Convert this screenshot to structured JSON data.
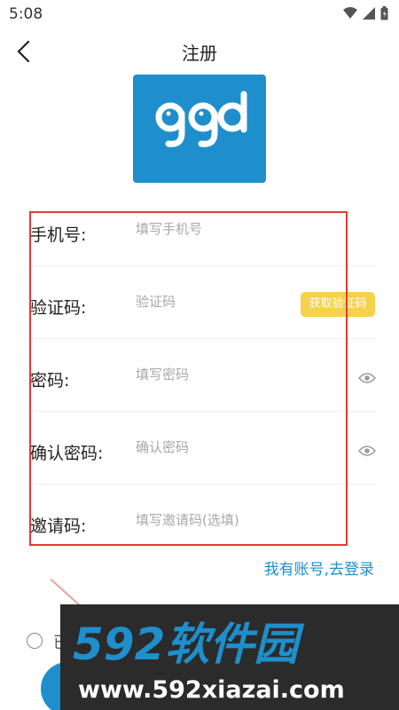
{
  "status_bar": {
    "time": "5:08",
    "icons": [
      "wifi-icon",
      "cellular-icon",
      "battery-icon"
    ]
  },
  "nav": {
    "title": "注册",
    "back_icon": "chevron-left-icon"
  },
  "logo": {
    "text": "ggd",
    "background_color": "#1e8fcc"
  },
  "form": {
    "rows": [
      {
        "label": "手机号:",
        "placeholder": "填写手机号"
      },
      {
        "label": "验证码:",
        "placeholder": "验证码",
        "action_label": "获取验证码"
      },
      {
        "label": "密码:",
        "placeholder": "填写密码",
        "icon": "eye-icon"
      },
      {
        "label": "确认密码:",
        "placeholder": "确认密码",
        "icon": "eye-icon"
      },
      {
        "label": "邀请码:",
        "placeholder": "填写邀请码(选填)"
      }
    ]
  },
  "login_link": "我有账号,去登录",
  "agreement": {
    "visible_text": "已"
  },
  "watermark": {
    "brand": "592软件园",
    "url": "www.592xiazai.com"
  },
  "colors": {
    "accent": "#1e8fcc",
    "code_button": "#f6d24a",
    "highlight": "#e53935"
  }
}
